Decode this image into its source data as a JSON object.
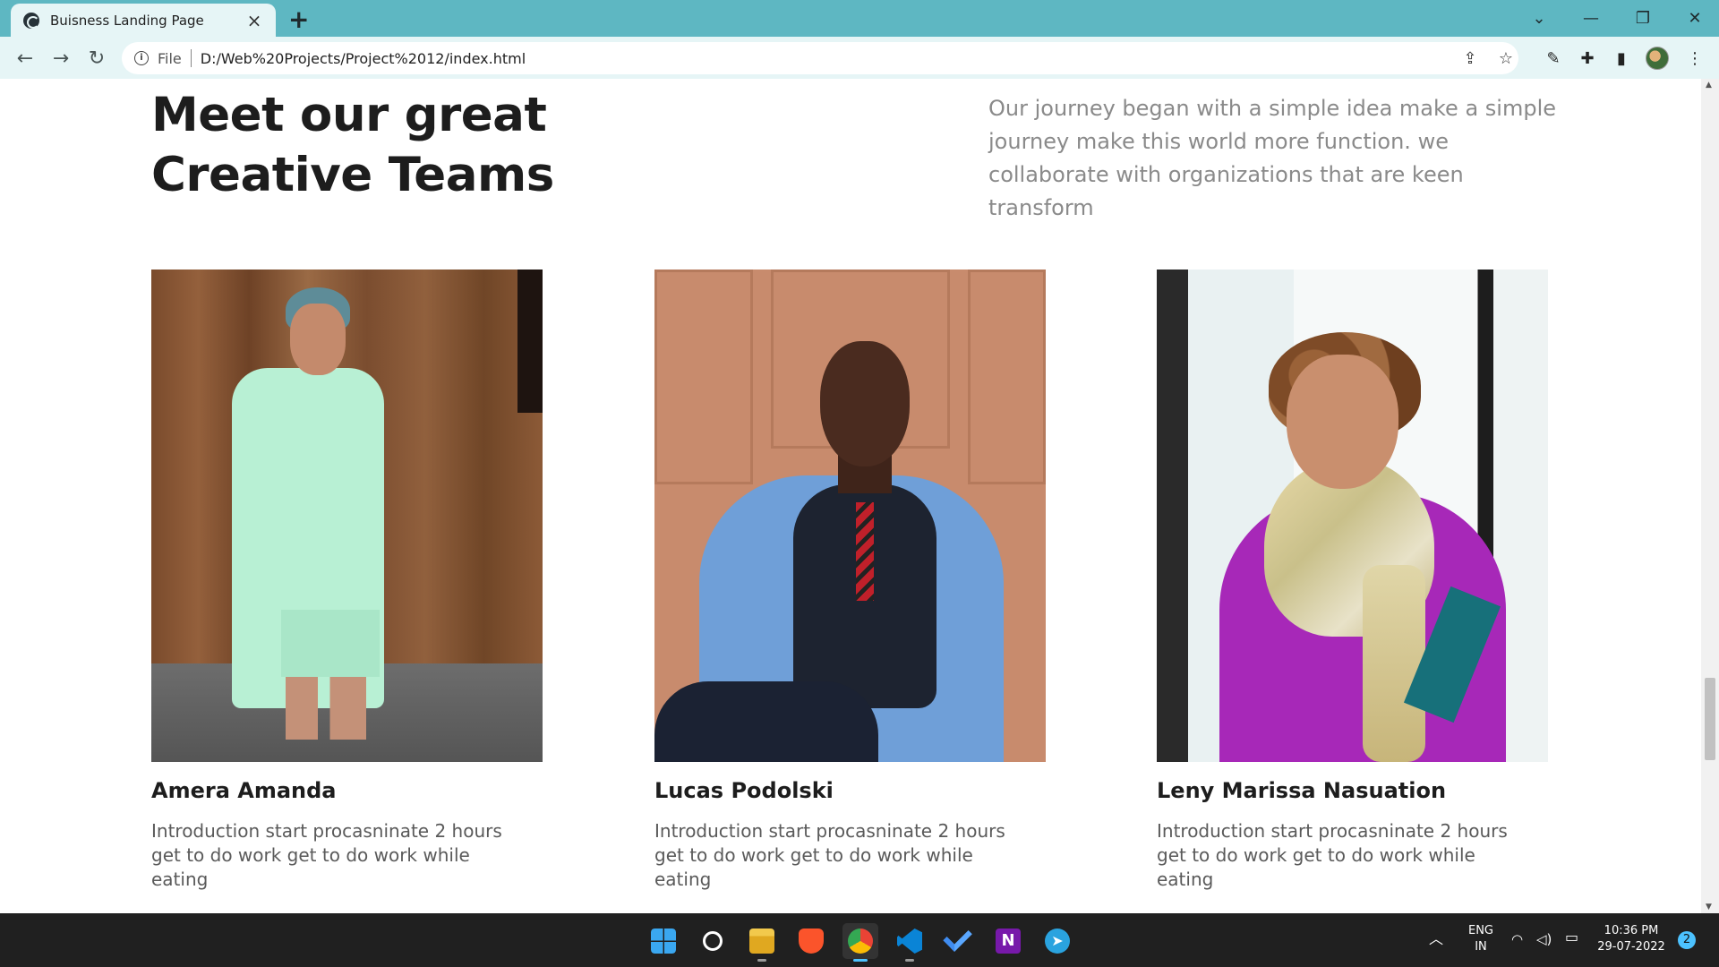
{
  "browser": {
    "tab_title": "Buisness Landing Page",
    "url_scheme": "File",
    "url": "D:/Web%20Projects/Project%2012/index.html"
  },
  "page": {
    "heading_line1": "Meet our great",
    "heading_line2": "Creative Teams",
    "lead": "Our journey began with a simple idea make a simple journey make this world more function. we collaborate with organizations that are keen transform",
    "team": [
      {
        "name": "Amera Amanda",
        "description": "Introduction start procasninate 2 hours get to do work get to do work while eating"
      },
      {
        "name": "Lucas Podolski",
        "description": "Introduction start procasninate 2 hours get to do work get to do work while eating"
      },
      {
        "name": "Leny Marissa Nasuation",
        "description": "Introduction start procasninate 2 hours get to do work get to do work while eating"
      }
    ]
  },
  "taskbar": {
    "language": "ENG",
    "region": "IN",
    "time": "10:36 PM",
    "date": "29-07-2022",
    "notification_count": "2",
    "apps": [
      "windows-start-icon",
      "search-icon",
      "file-explorer-icon",
      "brave-icon",
      "chrome-icon",
      "vscode-icon",
      "todo-icon",
      "onenote-icon",
      "telegram-icon"
    ]
  },
  "colors": {
    "chrome_accent": "#5eb7c2",
    "toolbar_bg": "#e6f5f6",
    "heading": "#1d1d1d",
    "lead_text": "#8a8a8a",
    "taskbar_bg": "#202020"
  }
}
